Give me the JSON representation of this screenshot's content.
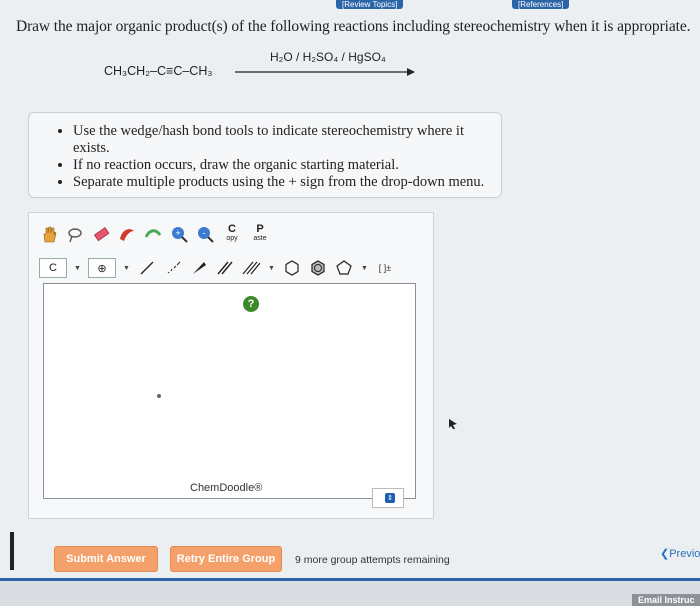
{
  "nav": {
    "review_topics": "[Review Topics]",
    "references": "[References]"
  },
  "question": {
    "prompt": "Draw the major organic product(s) of the following reactions including stereochemistry when it is appropriate.",
    "reactant": "CH₃CH₂–C≡C–CH₃",
    "reagents": "H₂O / H₂SO₄ / HgSO₄"
  },
  "instructions": [
    "Use the wedge/hash bond tools to indicate stereochemistry where it exists.",
    "If no reaction occurs, draw the organic starting material.",
    "Separate multiple products using the + sign from the drop-down menu."
  ],
  "chemdoodle": {
    "copy_label": "C",
    "copy_sub": "opy",
    "paste_label": "P",
    "paste_sub": "aste",
    "element_select": "C",
    "charge_label": "⊕",
    "bracket_label": "[ ]±",
    "help": "?",
    "brand": "ChemDoodle®"
  },
  "actions": {
    "submit": "Submit Answer",
    "retry": "Retry Entire Group",
    "attempts": "9 more group attempts remaining",
    "previous": "Previo"
  },
  "footer": {
    "email": "Email Instruc"
  },
  "colors": {
    "accent": "#2c64a8",
    "button": "#f4a06a",
    "help": "#3a8a2a"
  }
}
